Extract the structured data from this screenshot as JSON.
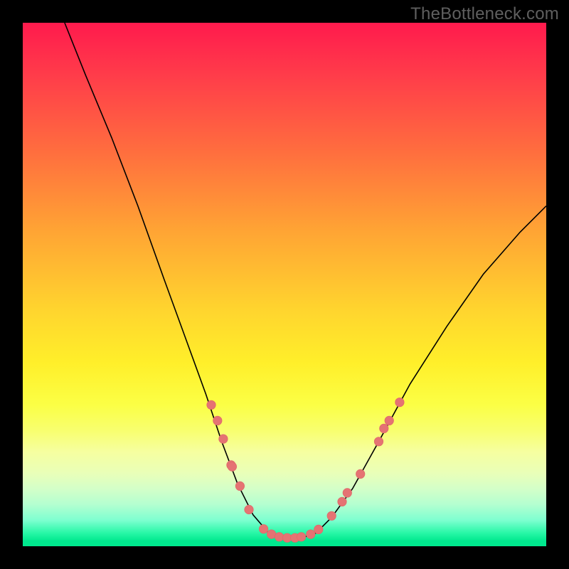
{
  "watermark": "TheBottleneck.com",
  "chart_data": {
    "type": "line",
    "title": "",
    "xlabel": "",
    "ylabel": "",
    "xlim": [
      0,
      100
    ],
    "ylim": [
      0,
      100
    ],
    "curve": {
      "name": "bottleneck-curve",
      "points": [
        {
          "x": 8.0,
          "y": 100.0
        },
        {
          "x": 12.0,
          "y": 90.0
        },
        {
          "x": 17.0,
          "y": 78.0
        },
        {
          "x": 22.0,
          "y": 65.0
        },
        {
          "x": 27.0,
          "y": 51.0
        },
        {
          "x": 31.0,
          "y": 40.0
        },
        {
          "x": 35.0,
          "y": 29.0
        },
        {
          "x": 38.0,
          "y": 20.0
        },
        {
          "x": 41.0,
          "y": 12.0
        },
        {
          "x": 44.0,
          "y": 6.0
        },
        {
          "x": 47.0,
          "y": 2.5
        },
        {
          "x": 50.0,
          "y": 1.5
        },
        {
          "x": 53.0,
          "y": 1.5
        },
        {
          "x": 56.0,
          "y": 2.5
        },
        {
          "x": 59.0,
          "y": 5.5
        },
        {
          "x": 63.0,
          "y": 11.0
        },
        {
          "x": 68.0,
          "y": 20.0
        },
        {
          "x": 74.0,
          "y": 31.0
        },
        {
          "x": 81.0,
          "y": 42.0
        },
        {
          "x": 88.0,
          "y": 52.0
        },
        {
          "x": 95.0,
          "y": 60.0
        },
        {
          "x": 100.0,
          "y": 65.0
        }
      ]
    },
    "dots": {
      "name": "markers",
      "points": [
        {
          "x": 36.0,
          "y": 27.0
        },
        {
          "x": 37.2,
          "y": 24.0
        },
        {
          "x": 38.3,
          "y": 20.5
        },
        {
          "x": 39.8,
          "y": 15.5
        },
        {
          "x": 40.0,
          "y": 15.2
        },
        {
          "x": 41.5,
          "y": 11.5
        },
        {
          "x": 43.2,
          "y": 7.0
        },
        {
          "x": 46.0,
          "y": 3.3
        },
        {
          "x": 47.5,
          "y": 2.3
        },
        {
          "x": 49.0,
          "y": 1.8
        },
        {
          "x": 50.5,
          "y": 1.6
        },
        {
          "x": 52.0,
          "y": 1.6
        },
        {
          "x": 53.2,
          "y": 1.8
        },
        {
          "x": 55.0,
          "y": 2.3
        },
        {
          "x": 56.5,
          "y": 3.2
        },
        {
          "x": 59.0,
          "y": 5.8
        },
        {
          "x": 61.0,
          "y": 8.5
        },
        {
          "x": 62.0,
          "y": 10.2
        },
        {
          "x": 64.5,
          "y": 13.8
        },
        {
          "x": 68.0,
          "y": 20.0
        },
        {
          "x": 69.0,
          "y": 22.5
        },
        {
          "x": 70.0,
          "y": 24.0
        },
        {
          "x": 72.0,
          "y": 27.5
        }
      ]
    },
    "colors": {
      "gradient_top": "#ff1a4d",
      "gradient_mid": "#ffd52e",
      "gradient_bottom": "#00e88e",
      "curve": "#000000",
      "dots": "#e57373",
      "frame": "#000000"
    }
  }
}
